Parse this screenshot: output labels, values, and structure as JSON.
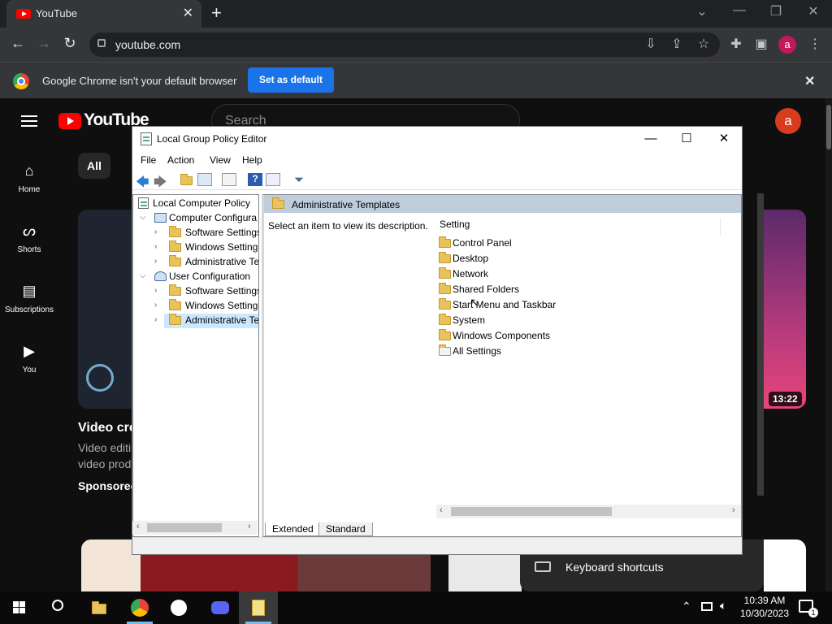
{
  "browser": {
    "tab_title": "YouTube",
    "tab_close": "✕",
    "new_tab": "+",
    "url": "youtube.com",
    "profile_initial": "a",
    "infobar": {
      "message": "Google Chrome isn't your default browser",
      "set_default_label": "Set as default",
      "close": "✕"
    }
  },
  "youtube": {
    "logo_text": "YouTube",
    "search_placeholder": "Search",
    "avatar_initial": "a",
    "sidebar": [
      {
        "label": "Home",
        "icon": "home-icon"
      },
      {
        "label": "Shorts",
        "icon": "shorts-icon"
      },
      {
        "label": "Subscriptions",
        "icon": "subscriptions-icon"
      },
      {
        "label": "You",
        "icon": "you-icon"
      }
    ],
    "chip_all": "All",
    "video": {
      "title": "Video cre",
      "line1": "Video editi",
      "line2": "video prod",
      "sponsored": "Sponsorec",
      "duration": "13:22"
    },
    "keyboard_shortcuts": "Keyboard shortcuts"
  },
  "gpedit": {
    "title": "Local Group Policy Editor",
    "menu": [
      "File",
      "Action",
      "View",
      "Help"
    ],
    "tree": {
      "root": "Local Computer Policy",
      "computer": "Computer Configura",
      "computer_children": [
        "Software Settings",
        "Windows Setting",
        "Administrative Te"
      ],
      "user": "User Configuration",
      "user_children": [
        "Software Settings",
        "Windows Setting",
        "Administrative Te"
      ]
    },
    "header": "Administrative Templates",
    "description": "Select an item to view its description.",
    "column_setting": "Setting",
    "items": [
      "Control Panel",
      "Desktop",
      "Network",
      "Shared Folders",
      "Start Menu and Taskbar",
      "System",
      "Windows Components",
      "All Settings"
    ],
    "tabs": [
      "Extended",
      "Standard"
    ]
  },
  "taskbar": {
    "time": "10:39 AM",
    "date": "10/30/2023",
    "notification_count": "1"
  }
}
